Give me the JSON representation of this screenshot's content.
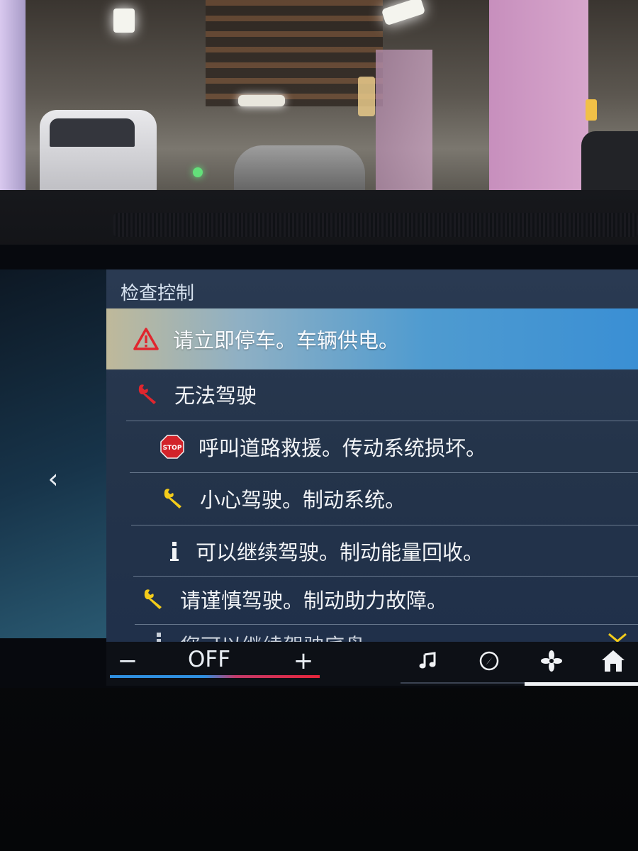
{
  "panel": {
    "title": "检查控制"
  },
  "messages": [
    {
      "icon": "warning-triangle-icon",
      "text": "请立即停车。车辆供电。",
      "selected": true
    },
    {
      "icon": "wrench-red-icon",
      "text": "无法驾驶"
    },
    {
      "icon": "stop-sign-icon",
      "text": "呼叫道路救援。传动系统损坏。"
    },
    {
      "icon": "wrench-yellow-icon",
      "text": "小心驾驶。制动系统。"
    },
    {
      "icon": "info-icon",
      "text": "可以继续驾驶。制动能量回收。"
    },
    {
      "icon": "wrench-yellow-icon",
      "text": "请谨慎驾驶。制动助力故障。"
    },
    {
      "icon": "info-icon",
      "text": "您可以继续驾驶底盘"
    }
  ],
  "climate": {
    "minus_label": "−",
    "value": "OFF",
    "plus_label": "+"
  },
  "bottom_nav": [
    {
      "icon": "music-icon"
    },
    {
      "icon": "navigation-icon"
    },
    {
      "icon": "fan-icon"
    },
    {
      "icon": "home-icon",
      "active": true
    }
  ],
  "colors": {
    "selected_highlight": "#3a8fd4",
    "panel_bg": "#24344a",
    "warning_red": "#e0262e",
    "wrench_yellow": "#f4cc1a"
  }
}
